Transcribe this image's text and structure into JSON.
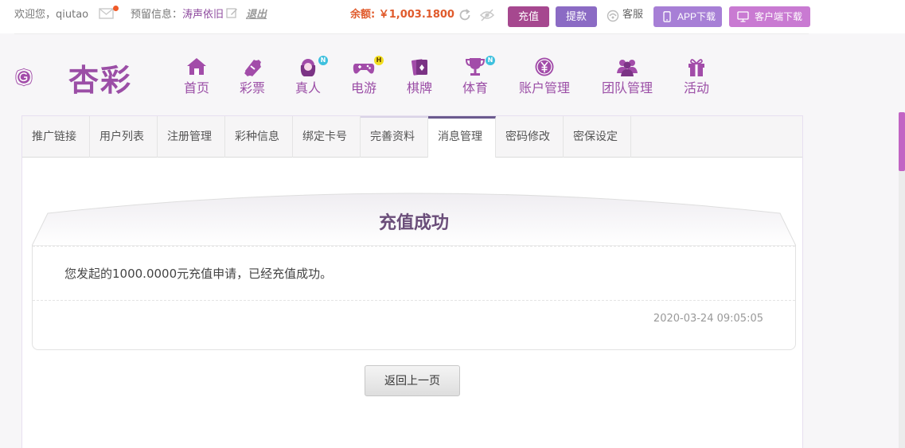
{
  "topbar": {
    "welcome_prefix": "欢迎您，",
    "username": "qiutao",
    "reserve_label": "预留信息：",
    "reserve_value": "涛声依旧",
    "logout": "退出",
    "balance": "余额: ￥1,003.1800",
    "recharge": "充值",
    "withdraw": "提款",
    "service": "客服",
    "app_download": "APP下载",
    "client_download": "客户端下载"
  },
  "logo": {
    "text": "杏彩"
  },
  "nav": [
    {
      "label": "首页",
      "icon": "home-icon",
      "badge": ""
    },
    {
      "label": "彩票",
      "icon": "ticket-icon",
      "badge": ""
    },
    {
      "label": "真人",
      "icon": "dealer-icon",
      "badge": "N"
    },
    {
      "label": "电游",
      "icon": "gamepad-icon",
      "badge": "H"
    },
    {
      "label": "棋牌",
      "icon": "cards-icon",
      "badge": ""
    },
    {
      "label": "体育",
      "icon": "trophy-icon",
      "badge": "N"
    },
    {
      "label": "账户管理",
      "icon": "yen-coin-icon",
      "badge": ""
    },
    {
      "label": "团队管理",
      "icon": "team-icon",
      "badge": ""
    },
    {
      "label": "活动",
      "icon": "gift-icon",
      "badge": ""
    }
  ],
  "tabs": [
    {
      "label": "推广链接"
    },
    {
      "label": "用户列表"
    },
    {
      "label": "注册管理"
    },
    {
      "label": "彩种信息"
    },
    {
      "label": "绑定卡号"
    },
    {
      "label": "完善资料"
    },
    {
      "label": "消息管理"
    },
    {
      "label": "密码修改"
    },
    {
      "label": "密保设定"
    }
  ],
  "active_tab": "消息管理",
  "message": {
    "title": "充值成功",
    "body": "您发起的1000.0000元充值申请，已经充值成功。",
    "time": "2020-03-24 09:05:05"
  },
  "back_button": "返回上一页",
  "colors": {
    "brand_purple": "#9b4ea6",
    "recharge_button": "#a6488f",
    "withdraw_button": "#8b6bc4",
    "balance_text": "#e05a2b"
  }
}
